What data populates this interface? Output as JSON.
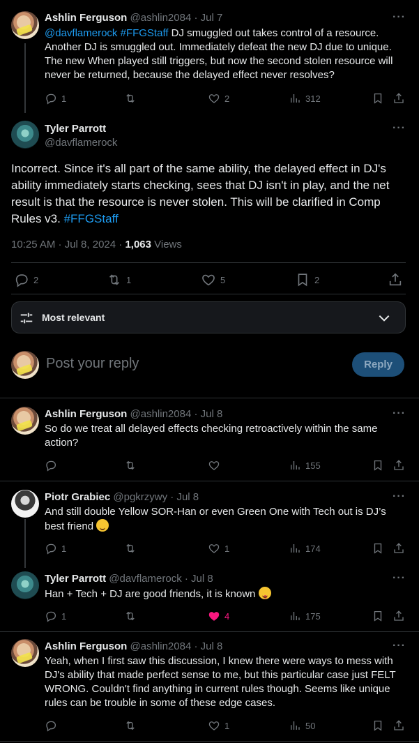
{
  "tweet1": {
    "name": "Ashlin Ferguson",
    "handle": "@ashlin2084",
    "date": "· Jul 7",
    "mentions": "@davflamerock #FFGStaff",
    "text_line1_rest": " DJ smuggled out takes control of a resource.",
    "text_lines": [
      "Another DJ is smuggled out. Immediately defeat the new DJ due to unique.",
      "The new When played still triggers, but now the second stolen resource will",
      "never be returned, because the delayed effect never resolves?"
    ],
    "replies": "1",
    "reposts": "",
    "likes": "2",
    "views": "312"
  },
  "main": {
    "name": "Tyler Parrott",
    "handle": "@davflamerock",
    "text_lines": [
      "Incorrect. Since it's all part of the same ability, the delayed effect in DJ's",
      "ability immediately starts checking, sees that DJ isn't in play, and the net",
      "result is that the resource is never stolen. This will be clarified in Comp"
    ],
    "text_last": "Rules v3. ",
    "hashtag": "#FFGStaff",
    "timestamp": "10:25 AM · Jul 8, 2024 · ",
    "views_count": "1,063",
    "views_label": " Views",
    "replies": "2",
    "reposts": "1",
    "likes": "5",
    "bookmarks": "2"
  },
  "sort": {
    "label": "Most relevant"
  },
  "compose": {
    "placeholder": "Post your reply",
    "button": "Reply"
  },
  "replies": [
    {
      "name": "Ashlin Ferguson",
      "handle": "@ashlin2084",
      "date": "· Jul 8",
      "lines": [
        "So do we treat all delayed effects checking retroactively within the same",
        "action?"
      ],
      "replies": "",
      "reposts": "",
      "likes": "",
      "views": "155"
    },
    {
      "name": "Piotr Grabiec",
      "handle": "@pgkrzywy",
      "date": "· Jul 8",
      "lines": [
        "And still double Yellow SOR-Han or even Green One with Tech out is DJ’s",
        "best friend"
      ],
      "replies": "1",
      "reposts": "",
      "likes": "1",
      "views": "174"
    },
    {
      "name": "Tyler Parrott",
      "handle": "@davflamerock",
      "date": "· Jul 8",
      "lines": [
        "Han + Tech + DJ are good friends, it is known"
      ],
      "replies": "1",
      "reposts": "",
      "likes": "4",
      "views": "175",
      "like_color": "#f91880"
    },
    {
      "name": "Ashlin Ferguson",
      "handle": "@ashlin2084",
      "date": "· Jul 8",
      "lines": [
        "Yeah, when I first saw this discussion, I knew there were ways to mess with",
        "DJ's ability that made perfect sense to me, but this particular case just FELT",
        "WRONG. Couldn't find anything in current rules though. Seems like unique",
        "rules can be trouble in some of these edge cases."
      ],
      "replies": "",
      "reposts": "",
      "likes": "1",
      "views": "50"
    }
  ],
  "colors": {
    "accent": "#1d9bf0",
    "muted": "#71767b",
    "like": "#f91880"
  }
}
